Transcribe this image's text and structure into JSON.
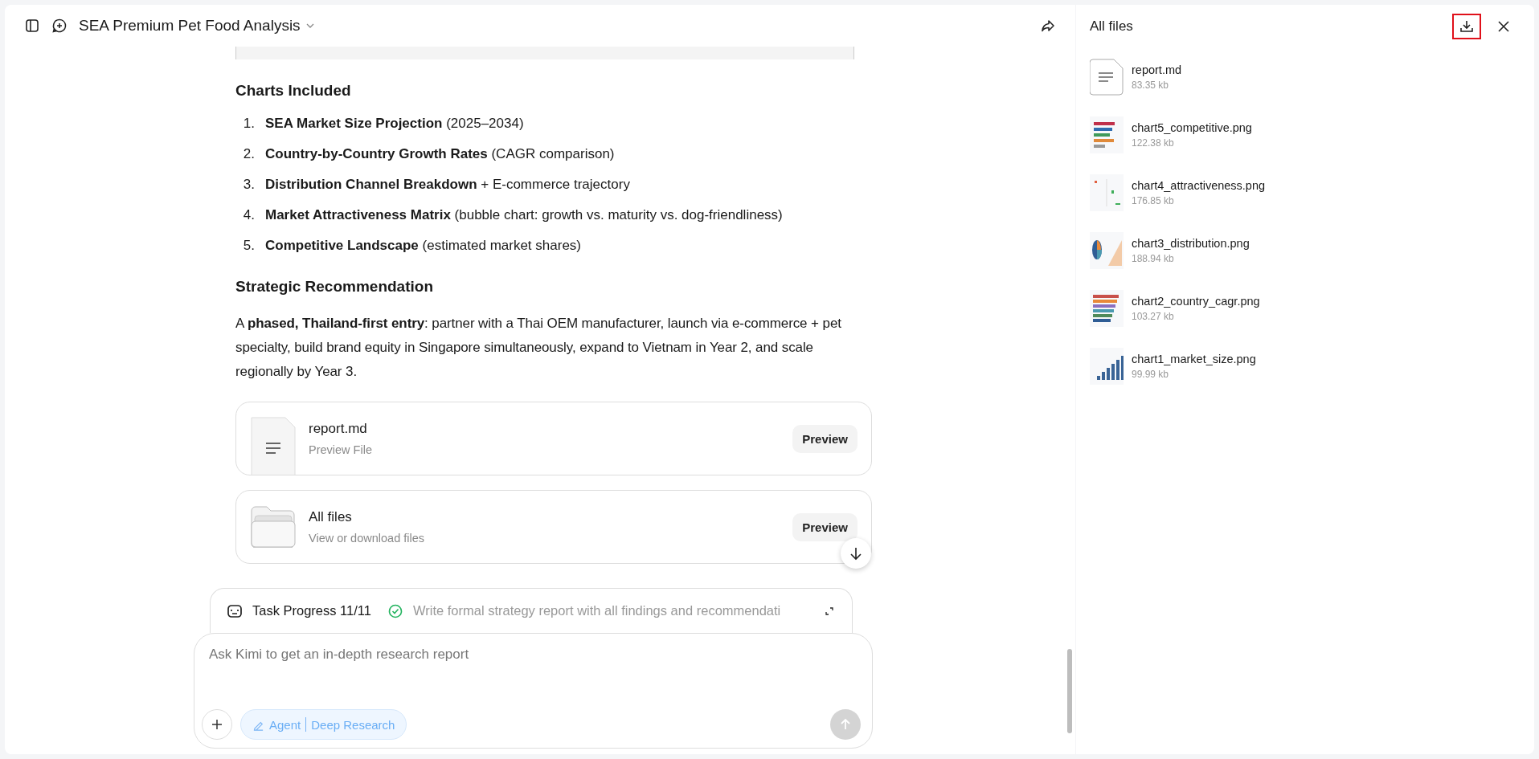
{
  "header": {
    "title": "SEA Premium Pet Food Analysis"
  },
  "charts_heading": "Charts Included",
  "chart_list": [
    {
      "number": "1.",
      "text": "**SEA Market Size Projection** (2025–2034)"
    },
    {
      "number": "2.",
      "text": "**Country-by-Country Growth Rates** (CAGR comparison)"
    },
    {
      "number": "3.",
      "text": "**Distribution Channel Breakdown** + E-commerce trajectory"
    },
    {
      "number": "4.",
      "text": "**Market Attractiveness Matrix** (bubble chart: growth vs. maturity vs. dog-friendliness)"
    },
    {
      "number": "5.",
      "text": "**Competitive Landscape** (estimated market shares)"
    }
  ],
  "recommendation": {
    "heading": "Strategic Recommendation",
    "text": "A **phased, Thailand-first entry**: partner with a Thai OEM manufacturer, launch via e-commerce + pet specialty, build brand equity in Singapore simultaneously, expand to Vietnam in Year 2, and scale regionally by Year 3."
  },
  "file_cards": [
    {
      "kind": "file",
      "name": "report.md",
      "subtitle": "Preview File",
      "button": "Preview"
    },
    {
      "kind": "folder",
      "name": "All files",
      "subtitle": "View or download files",
      "button": "Preview"
    }
  ],
  "task_progress": {
    "completed": true,
    "label": "Task Progress 11/11",
    "task": "Write formal strategy report with all findings and recommendati"
  },
  "composer": {
    "placeholder": "Ask Kimi to get an in-depth research report",
    "mode": "Agent",
    "mode_detail": "Deep Research"
  },
  "files_panel": {
    "title": "All files",
    "download_highlighted": true,
    "files": [
      {
        "kind": "document",
        "name": "report.md",
        "size": "83.35 kb"
      },
      {
        "name": "chart5_competitive.png",
        "size": "122.38 kb"
      },
      {
        "name": "chart4_attractiveness.png",
        "size": "176.85 kb"
      },
      {
        "name": "chart3_distribution.png",
        "size": "188.94 kb"
      },
      {
        "name": "chart2_country_cagr.png",
        "size": "103.27 kb"
      },
      {
        "name": "chart1_market_size.png",
        "size": "99.99 kb"
      }
    ]
  }
}
